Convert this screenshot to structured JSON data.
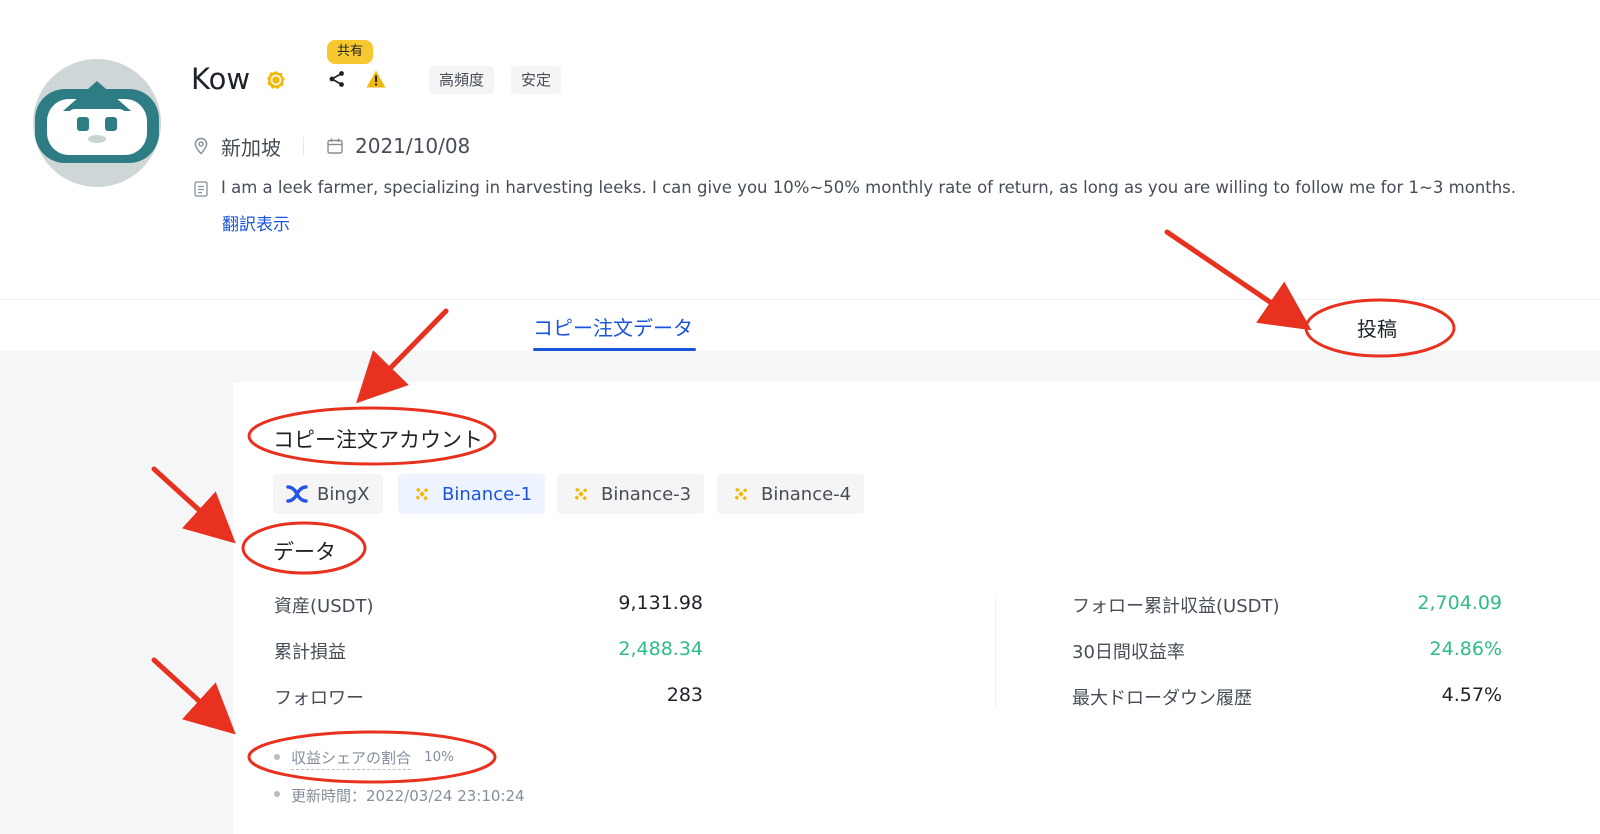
{
  "profile": {
    "name": "Kow",
    "shared_badge": "共有",
    "tags": [
      "高頻度",
      "安定"
    ],
    "location": "新加坡",
    "date": "2021/10/08",
    "bio": "I am a leek farmer, specializing in harvesting leeks. I can give you 10%~50% monthly rate of return, as long as you are willing to follow me for 1~3 months.",
    "translate_link": "翻訳表示"
  },
  "tabs": {
    "copy_data": "コピー注文データ",
    "posts": "投稿"
  },
  "accounts_section": {
    "title": "コピー注文アカウント",
    "accounts": [
      {
        "label": "BingX",
        "icon": "bingx-logo-icon",
        "active": false
      },
      {
        "label": "Binance-1",
        "icon": "binance-logo-icon",
        "active": true
      },
      {
        "label": "Binance-3",
        "icon": "binance-logo-icon",
        "active": false
      },
      {
        "label": "Binance-4",
        "icon": "binance-logo-icon",
        "active": false
      }
    ]
  },
  "data_section": {
    "title": "データ",
    "left": [
      {
        "label": "資産(USDT)",
        "value": "9,131.98"
      },
      {
        "label": "累計損益",
        "value": "2,488.34"
      },
      {
        "label": "フォロワー",
        "value": "283"
      }
    ],
    "right": [
      {
        "label": "フォロー累計収益(USDT)",
        "value": "2,704.09"
      },
      {
        "label": "30日間収益率",
        "value": "24.86%"
      },
      {
        "label": "最大ドローダウン履歴",
        "value": "4.57%"
      }
    ],
    "profit_share_label": "収益シェアの割合",
    "profit_share_value": "10%",
    "updated": "更新時間：2022/03/24 23:10:24"
  },
  "colors": {
    "accent_blue": "#1a54dd",
    "positive_green": "#2ebd85",
    "badge_yellow": "#f7c830",
    "annotation_red": "#e8311f"
  }
}
